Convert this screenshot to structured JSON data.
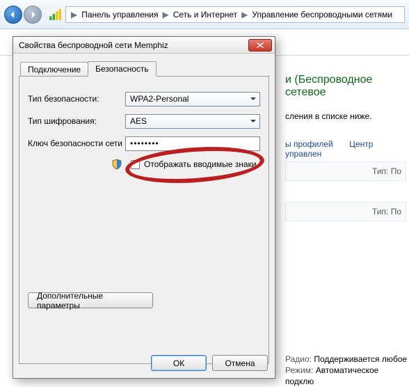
{
  "breadcrumbs": {
    "item1": "Панель управления",
    "item2": "Сеть и Интернет",
    "item3": "Управление беспроводными сетями"
  },
  "right": {
    "title_suffix": "и (Беспроводное сетевое",
    "desc": "сления в списке ниже.",
    "link1": "ы профилей",
    "link2": "Центр управлен",
    "row_label": "Тип: По",
    "foot_radio_k": "Радио:",
    "foot_radio_v": "Поддерживается любое",
    "foot_mode_k": "Режим:",
    "foot_mode_v": "Автоматическое подклю"
  },
  "dialog": {
    "title": "Свойства беспроводной сети Memphiz",
    "tab_connect": "Подключение",
    "tab_security": "Безопасность",
    "lbl_sectype": "Тип безопасности:",
    "val_sectype": "WPA2-Personal",
    "lbl_enc": "Тип шифрования:",
    "val_enc": "AES",
    "lbl_key": "Ключ безопасности сети",
    "val_key": "••••••••",
    "chk_show": "Отображать вводимые знаки",
    "btn_adv": "Дополнительные параметры",
    "btn_ok": "ОК",
    "btn_cancel": "Отмена"
  }
}
